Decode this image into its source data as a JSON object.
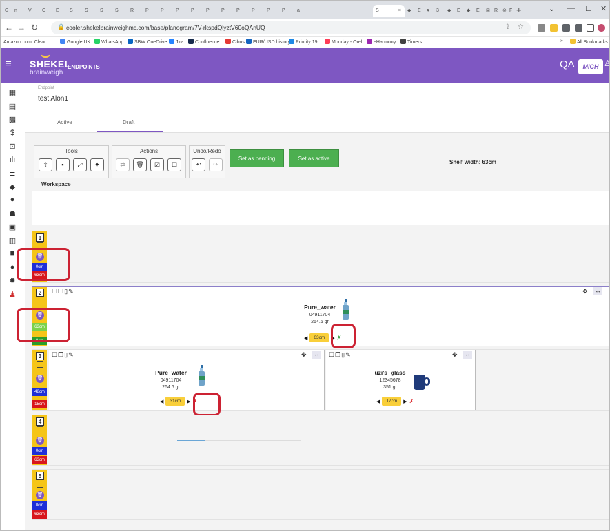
{
  "browser": {
    "url": "cooler.shekelbrainweighmc.com/base/planogram/7V-rkspdQlyztV60oQAnUQ",
    "tab_favicons": [
      "G",
      "n",
      "V",
      "C",
      "E",
      "S",
      "S",
      "S",
      "S",
      "R",
      "P",
      "P",
      "P",
      "P",
      "P",
      "P",
      "P",
      "P",
      "P",
      "P",
      "a"
    ],
    "active_tab_label": "S",
    "active_tab_close": "×",
    "trailing_tabs": [
      "◆",
      "E",
      "♥",
      "3",
      "◆",
      "E",
      "◆",
      "E",
      "⊠",
      "R",
      "⊘",
      "F"
    ],
    "new_tab": "+",
    "bookmarks": [
      {
        "label": "Amazon.com: Clear...",
        "color": "#ffffff"
      },
      {
        "label": "Google UK",
        "color": "#4285f4"
      },
      {
        "label": "WhatsApp",
        "color": "#25d366"
      },
      {
        "label": "SBW OneDrive",
        "color": "#0a66c2"
      },
      {
        "label": "Jira",
        "color": "#2684ff"
      },
      {
        "label": "Confluence",
        "color": "#172b4d"
      },
      {
        "label": "Cibus",
        "color": "#e53935"
      },
      {
        "label": "EUR/USD history",
        "color": "#1565c0"
      },
      {
        "label": "Priority 19",
        "color": "#1e88e5"
      },
      {
        "label": "Monday - Orel",
        "color": "#ff3d57"
      },
      {
        "label": "eHarmony",
        "color": "#9c27b0"
      },
      {
        "label": "Timers",
        "color": "#424242"
      }
    ],
    "bookmarks_more": "»",
    "all_bookmarks": "All Bookmarks"
  },
  "app": {
    "logo_main": "SHEKEL",
    "logo_sub": "brainweigh",
    "title": "ENDPOINTS",
    "env": "QA",
    "brand": "MICH",
    "accent": "#7e57c2"
  },
  "endpoint": {
    "label": "Endpoint",
    "value": "test Alon1"
  },
  "tabs": [
    "Active",
    "Draft"
  ],
  "toolbar": {
    "tools_label": "Tools",
    "actions_label": "Actions",
    "undo_label": "Undo/Redo",
    "set_pending": "Set as pending",
    "set_active": "Set as active",
    "shelf_width": "Shelf width: 63cm"
  },
  "workspace_label": "Workspace",
  "shelves": [
    {
      "num": "1",
      "used": "0cm",
      "free": "63cm",
      "used_color": "#1e2fd8",
      "free_color": "#d8161c"
    },
    {
      "num": "2",
      "used": "63cm",
      "free": "0cm",
      "used_color": "#7bd24a",
      "free_color": "#2a9d2a",
      "products": [
        {
          "name": "Pure_water",
          "code": "04911704",
          "weight": "264.6 gr",
          "width": "63cm",
          "pin_color": "#2e9b3a"
        }
      ]
    },
    {
      "num": "3",
      "used": "48cm",
      "free": "15cm",
      "used_color": "#1e2fd8",
      "free_color": "#d8161c",
      "products": [
        {
          "name": "Pure_water",
          "code": "04911704",
          "weight": "264.6 gr",
          "width": "31cm",
          "pin_color": "#d8161c"
        },
        {
          "name": "uzi's_glass",
          "code": "12345678",
          "weight": "351 gr",
          "width": "17cm",
          "pin_color": "#d8161c"
        }
      ]
    },
    {
      "num": "4",
      "used": "0cm",
      "free": "63cm",
      "used_color": "#1e2fd8",
      "free_color": "#d8161c"
    },
    {
      "num": "5",
      "used": "0cm",
      "free": "63cm",
      "used_color": "#1e2fd8",
      "free_color": "#d8161c"
    }
  ]
}
